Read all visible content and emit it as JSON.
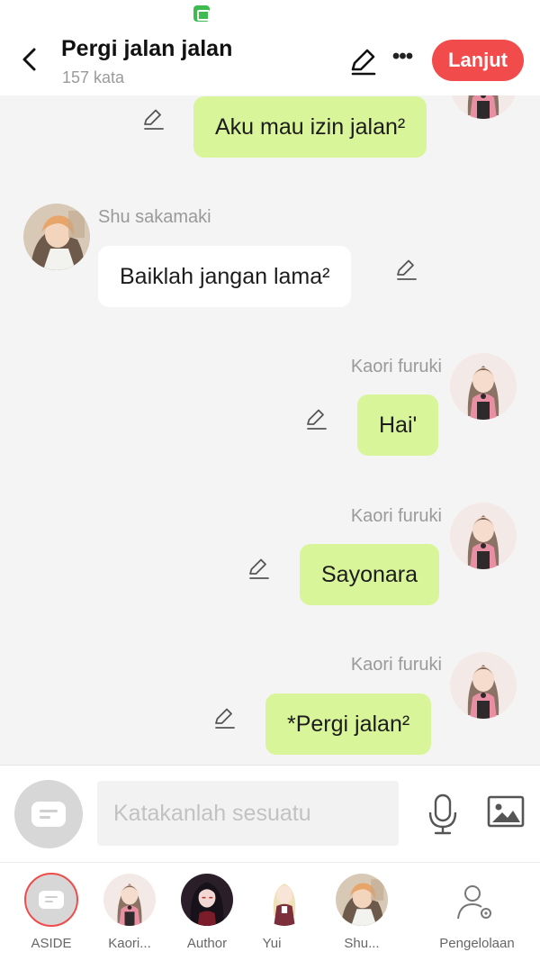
{
  "header": {
    "title": "Pergi jalan jalan",
    "word_count": "157 kata",
    "next_label": "Lanjut"
  },
  "messages": [
    {
      "side": "right",
      "sender": "",
      "text": "Aku mau izin jalan²"
    },
    {
      "side": "left",
      "sender": "Shu sakamaki",
      "text": "Baiklah jangan lama²"
    },
    {
      "side": "right",
      "sender": "Kaori furuki",
      "text": "Hai'"
    },
    {
      "side": "right",
      "sender": "Kaori furuki",
      "text": "Sayonara"
    },
    {
      "side": "right",
      "sender": "Kaori furuki",
      "text": "*Pergi jalan²"
    }
  ],
  "composer": {
    "placeholder": "Katakanlah sesuatu"
  },
  "bottom_tabs": [
    {
      "label": "ASIDE",
      "icon": "aside-chat-icon"
    },
    {
      "label": "Kaori..."
    },
    {
      "label": "Author"
    },
    {
      "label": "Yui"
    },
    {
      "label": "Shu..."
    },
    {
      "label": "Pengelolaan",
      "icon": "user-settings-icon"
    }
  ],
  "colors": {
    "accent": "#f24b4b",
    "my_bubble": "#d9f59a",
    "other_bubble": "#ffffff",
    "background": "#f4f4f4"
  }
}
